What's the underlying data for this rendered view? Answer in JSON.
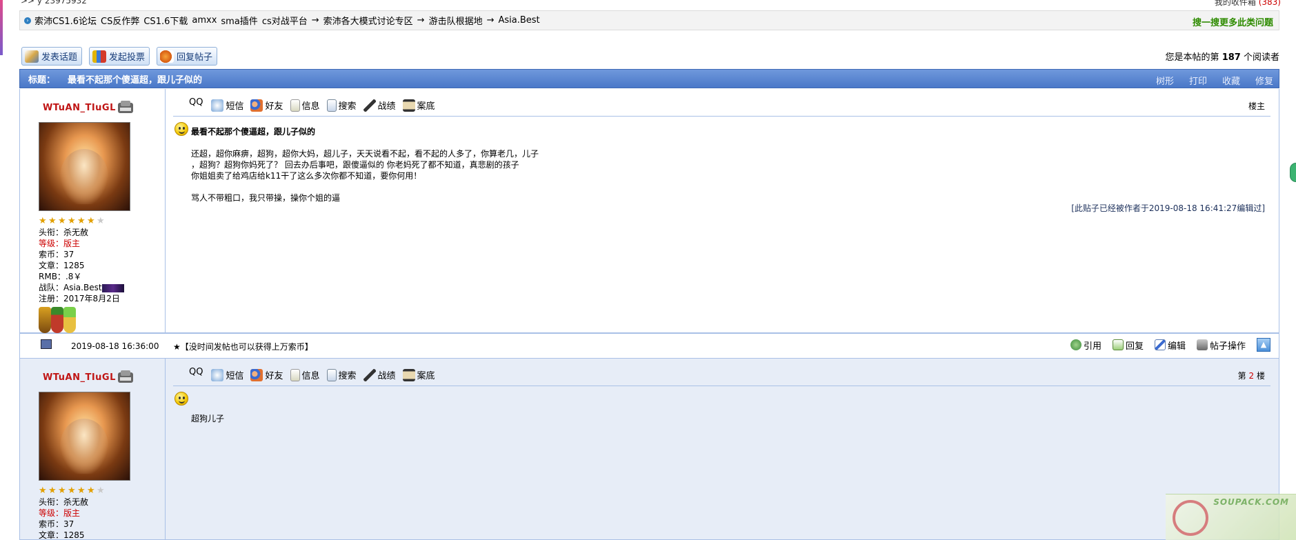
{
  "topline": {
    "left": ">> y 23975932",
    "right_label": "我的收件箱",
    "right_count": "(383)"
  },
  "breadcrumb": {
    "items": [
      "索沛CS1.6论坛",
      "CS反作弊",
      "CS1.6下载",
      "amxx",
      "sma插件",
      "cs对战平台",
      "→",
      "索沛各大模式讨论专区",
      "→",
      "游击队根据地",
      "→",
      "Asia.Best"
    ],
    "search_link": "搜一搜更多此类问题"
  },
  "actions": {
    "new_topic": "发表话题",
    "new_poll": "发起投票",
    "reply": "回复帖子"
  },
  "readers": {
    "prefix": "您是本帖的第",
    "count": "187",
    "suffix": "个阅读者"
  },
  "titlebar": {
    "label": "标题：",
    "title": "最看不起那个傻逼超，跟儿子似的",
    "tree": "树形",
    "print": "打印",
    "favorite": "收藏",
    "edit": "修复"
  },
  "post1": {
    "username": "WTuAN_TIuGL",
    "stars": 6,
    "stars_total": 7,
    "info": {
      "title_k": "头衔：",
      "title_v": "杀无赦",
      "level_k": "等级：",
      "level_v": "版主",
      "coins_k": "索币：",
      "coins_v": "37",
      "posts_k": "文章：",
      "posts_v": "1285",
      "rmb_k": "RMB：",
      "rmb_v": ".8￥",
      "team_k": "战队：",
      "team_v": "Asia.Best",
      "reg_k": "注册：",
      "reg_v": "2017年8月2日"
    },
    "toolbar": {
      "qq": "QQ",
      "sms": "短信",
      "friend": "好友",
      "info": "信息",
      "search": "搜索",
      "record": "战绩",
      "case": "案底"
    },
    "floor": "楼主",
    "post_title": "最看不起那个傻逼超，跟儿子似的",
    "body_lines": [
      "还超，超你麻痹，超狗，超你大妈，超儿子，天天说看不起，看不起的人多了，你算老几，儿子",
      "，超狗？超狗你妈死了？ 回去办后事吧，跟傻逼似的 你老妈死了都不知道，真悲剧的孩子",
      "你姐姐卖了给鸡店给k11干了这么多次你都不知道，要你何用！",
      "",
      "骂人不带粗口，我只带操，操你个姐的逼"
    ],
    "edited": "[此贴子已经被作者于2019-08-18 16:41:27编辑过]"
  },
  "footer1": {
    "time": "2019-08-18 16:36:00",
    "note": "★【没时间发帖也可以获得上万索币】",
    "quote": "引用",
    "reply": "回复",
    "edit": "编辑",
    "ops": "帖子操作"
  },
  "post2": {
    "username": "WTuAN_TIuGL",
    "stars": 6,
    "stars_total": 7,
    "info": {
      "title_k": "头衔：",
      "title_v": "杀无赦",
      "level_k": "等级：",
      "level_v": "版主",
      "coins_k": "索币：",
      "coins_v": "37",
      "posts_k": "文章：",
      "posts_v": "1285"
    },
    "toolbar": {
      "qq": "QQ",
      "sms": "短信",
      "friend": "好友",
      "info": "信息",
      "search": "搜索",
      "record": "战绩",
      "case": "案底"
    },
    "floor_prefix": "第",
    "floor_num": "2",
    "floor_suffix": "楼",
    "body_lines": [
      "超狗儿子"
    ]
  },
  "watermark": {
    "text": "SOUPACK.COM"
  },
  "colors": {
    "title_bar": "#5b86d2",
    "username": "#c01515",
    "search_link": "#2e8b00",
    "level": "#cc0000"
  }
}
